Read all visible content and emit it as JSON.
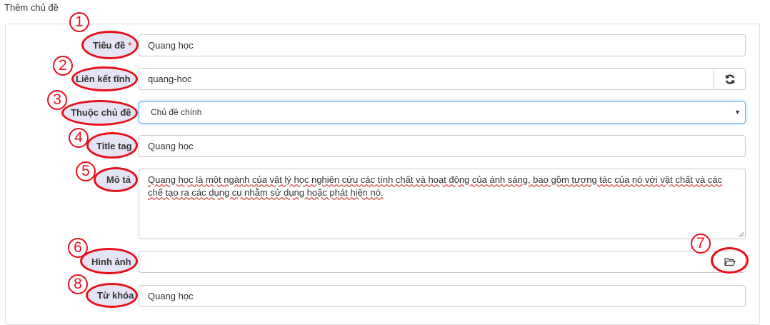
{
  "page": {
    "title": "Thêm chủ đề"
  },
  "form": {
    "title_label": "Tiêu đề",
    "title_required": "*",
    "title_value": "Quang học",
    "slug_label": "Liên kết tĩnh",
    "slug_value": "quang-hoc",
    "parent_label": "Thuộc chủ đề",
    "parent_selected": "Chủ đề chính",
    "title_tag_label": "Title tag",
    "title_tag_value": "Quang học",
    "description_label": "Mô tả",
    "description_value": "Quang học là một ngành của vật lý học nghiên cứu các tính chất và hoạt động của ánh sáng, bao gồm tương tác của nó với vật chất và các chế tạo ra các dụng cụ nhằm sử dụng hoặc phát hiện nó.",
    "image_label": "Hình ảnh",
    "image_value": "",
    "keywords_label": "Từ khóa",
    "keywords_value": "Quang học"
  },
  "annotations": [
    "1",
    "2",
    "3",
    "4",
    "5",
    "6",
    "7",
    "8"
  ],
  "icons": {
    "refresh": "refresh-icon",
    "folder": "folder-open-icon"
  },
  "colors": {
    "annotation": "#e8101a",
    "focus_border": "#66afe9",
    "required": "#d9534f"
  }
}
